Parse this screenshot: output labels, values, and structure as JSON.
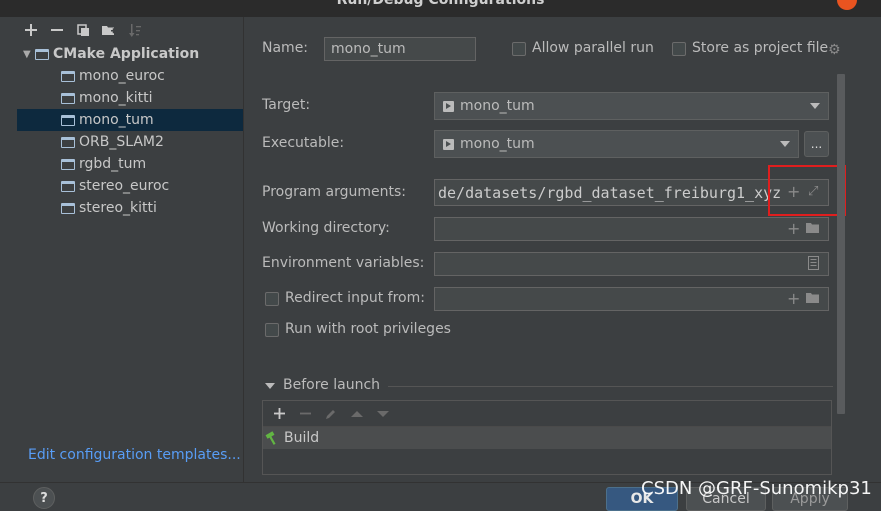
{
  "window": {
    "title": "Run/Debug Configurations"
  },
  "tree": {
    "root_label": "CMake Application",
    "items": [
      {
        "label": "mono_euroc",
        "selected": false
      },
      {
        "label": "mono_kitti",
        "selected": false
      },
      {
        "label": "mono_tum",
        "selected": true
      },
      {
        "label": "ORB_SLAM2",
        "selected": false
      },
      {
        "label": "rgbd_tum",
        "selected": false
      },
      {
        "label": "stereo_euroc",
        "selected": false
      },
      {
        "label": "stereo_kitti",
        "selected": false
      }
    ],
    "toolbar_icons": [
      "add-icon",
      "remove-icon",
      "copy-icon",
      "new-folder-icon",
      "sort-icon"
    ],
    "edit_templates_link": "Edit configuration templates..."
  },
  "form": {
    "name_label": "Name:",
    "name_value": "mono_tum",
    "allow_parallel_label": "Allow parallel run",
    "allow_parallel_checked": false,
    "store_project_label": "Store as project file",
    "store_project_checked": false,
    "target_label": "Target:",
    "target_value": "mono_tum",
    "executable_label": "Executable:",
    "executable_value": "mono_tum",
    "browse_label": "...",
    "program_args_label": "Program arguments:",
    "program_args_value": "de/datasets/rgbd_dataset_freiburg1_xyz",
    "working_dir_label": "Working directory:",
    "working_dir_value": "",
    "env_vars_label": "Environment variables:",
    "env_vars_value": "",
    "redirect_input_label": "Redirect input from:",
    "redirect_input_checked": false,
    "redirect_input_value": "",
    "run_root_label": "Run with root privileges",
    "run_root_checked": false
  },
  "before_launch": {
    "section_label": "Before launch",
    "items": [
      {
        "label": "Build"
      }
    ]
  },
  "buttons": {
    "help": "?",
    "ok": "OK",
    "cancel": "Cancel",
    "apply": "Apply"
  },
  "watermark": "CSDN @GRF-Sunomikp31",
  "colors": {
    "background": "#3c3f41",
    "selection": "#0d293e",
    "link": "#589df6",
    "highlight_box": "#e01e1e",
    "ok_button": "#365880"
  }
}
